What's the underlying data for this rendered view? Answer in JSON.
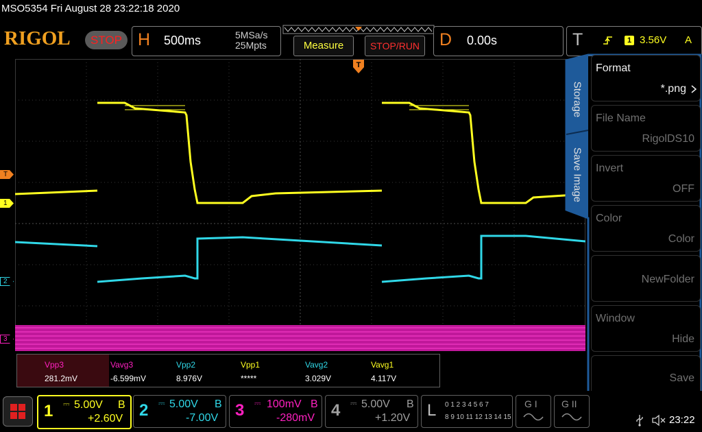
{
  "header": {
    "title": "MSO5354  Fri August 28 23:22:18 2020",
    "logo": "RIGOL",
    "run_state": "STOP",
    "h_label": "H",
    "timebase": "500ms",
    "sample_rate": "5MSa/s",
    "memory_depth": "25Mpts",
    "measure_label": "Measure",
    "stoprun_label": "STOP/RUN",
    "d_label": "D",
    "delay": "0.00s",
    "t_label": "T",
    "trigger_source": "1",
    "trigger_level": "3.56V",
    "trigger_mode": "A"
  },
  "sidebar": {
    "tab_storage": "Storage",
    "tab_save_image": "Save Image",
    "items": [
      {
        "title": "Format",
        "value": "*.png"
      },
      {
        "title": "File Name",
        "value": "RigolDS10"
      },
      {
        "title": "Invert",
        "value": "OFF"
      },
      {
        "title": "Color",
        "value": "Color"
      },
      {
        "title": "",
        "value": "NewFolder"
      },
      {
        "title": "Window",
        "value": "Hide"
      },
      {
        "title": "",
        "value": "Save"
      }
    ]
  },
  "markers": {
    "trigger": "T",
    "ch1": "1",
    "ch2": "2",
    "ch3": "3"
  },
  "measurements": [
    {
      "name": "Vpp3",
      "value": "281.2mV",
      "color": "#ff20c0"
    },
    {
      "name": "Vavg3",
      "value": "-6.599mV",
      "color": "#ff20c0"
    },
    {
      "name": "Vpp2",
      "value": "8.976V",
      "color": "#30d8e8"
    },
    {
      "name": "Vpp1",
      "value": "*****",
      "color": "#ffff20"
    },
    {
      "name": "Vavg2",
      "value": "3.029V",
      "color": "#30d8e8"
    },
    {
      "name": "Vavg1",
      "value": "4.117V",
      "color": "#ffff20"
    }
  ],
  "channels": [
    {
      "num": "1",
      "scale": "5.00V",
      "bw": "B",
      "offset": "+2.60V",
      "color": "#ffff20"
    },
    {
      "num": "2",
      "scale": "5.00V",
      "bw": "B",
      "offset": "-7.00V",
      "color": "#30d8e8"
    },
    {
      "num": "3",
      "scale": "100mV",
      "bw": "B",
      "offset": "-280mV",
      "color": "#ff20c0"
    },
    {
      "num": "4",
      "scale": "5.00V",
      "bw": "B",
      "offset": "+1.20V",
      "color": "#a0a0a0"
    }
  ],
  "logic": {
    "label": "L",
    "row1": "0 1 2 3  4 5 6 7",
    "row2": "8 9 10 11 12 13 14 15"
  },
  "gen1": "G I",
  "gen2": "G II",
  "clock": "23:22",
  "colors": {
    "ch1": "#ffff20",
    "ch2": "#30d8e8",
    "ch3": "#ff20c0",
    "accent": "#f08020",
    "panel_blue": "#1e5a9a"
  }
}
